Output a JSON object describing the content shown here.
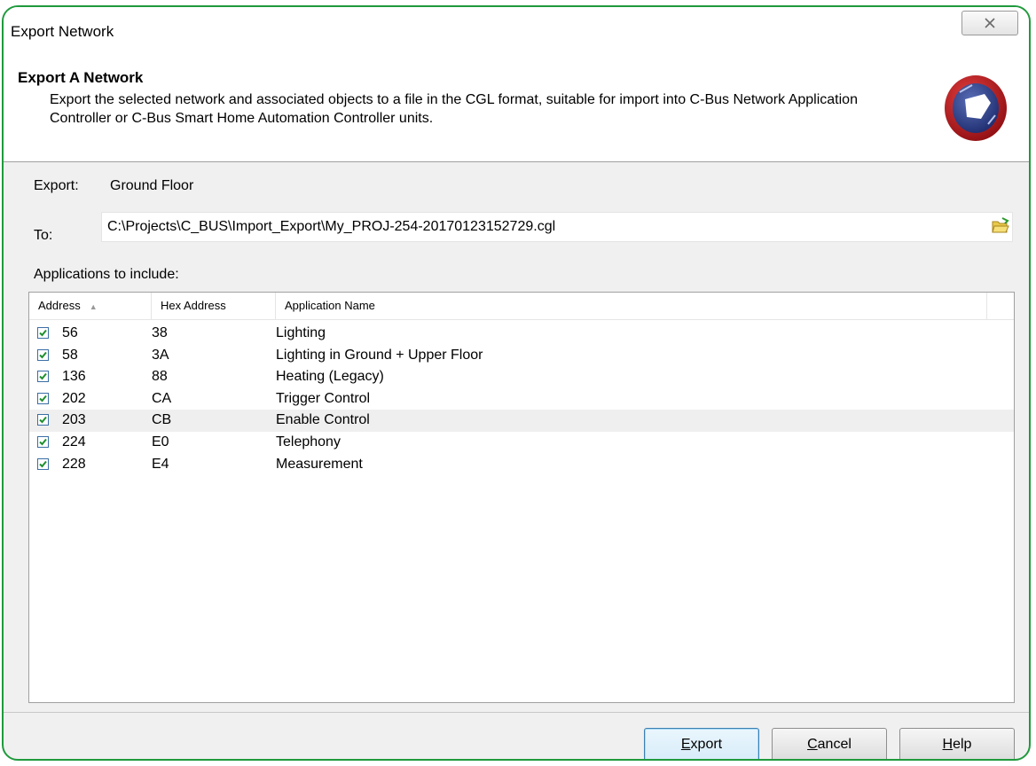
{
  "window": {
    "title": "Export Network"
  },
  "header": {
    "title": "Export A Network",
    "description": "Export the selected network and associated objects to a file in the CGL format, suitable for import into C-Bus Network Application Controller or C-Bus Smart Home Automation Controller units."
  },
  "export": {
    "label": "Export:",
    "value": "Ground Floor"
  },
  "to": {
    "label": "To:",
    "path": "C:\\Projects\\C_BUS\\Import_Export\\My_PROJ-254-20170123152729.cgl"
  },
  "applications": {
    "label": "Applications to include:",
    "columns": [
      "Address",
      "Hex Address",
      "Application Name"
    ],
    "rows": [
      {
        "address": "56",
        "hex": "38",
        "name": "Lighting",
        "checked": true
      },
      {
        "address": "58",
        "hex": "3A",
        "name": "Lighting in Ground + Upper Floor",
        "checked": true
      },
      {
        "address": "136",
        "hex": "88",
        "name": "Heating (Legacy)",
        "checked": true
      },
      {
        "address": "202",
        "hex": "CA",
        "name": "Trigger Control",
        "checked": true
      },
      {
        "address": "203",
        "hex": "CB",
        "name": "Enable Control",
        "checked": true
      },
      {
        "address": "224",
        "hex": "E0",
        "name": "Telephony",
        "checked": true
      },
      {
        "address": "228",
        "hex": "E4",
        "name": "Measurement",
        "checked": true
      }
    ]
  },
  "buttons": {
    "export_first": "E",
    "export_rest": "xport",
    "cancel_first": "C",
    "cancel_rest": "ancel",
    "help_first": "H",
    "help_rest": "elp"
  },
  "icons": {
    "close": "close-icon",
    "logo": "cbus-logo-icon",
    "browse": "folder-open-icon",
    "sort": "sort-ascending-icon"
  },
  "colors": {
    "window_border": "#1f9a3c",
    "logo_red": "#c0161c",
    "logo_blue": "#2c3f8c"
  }
}
